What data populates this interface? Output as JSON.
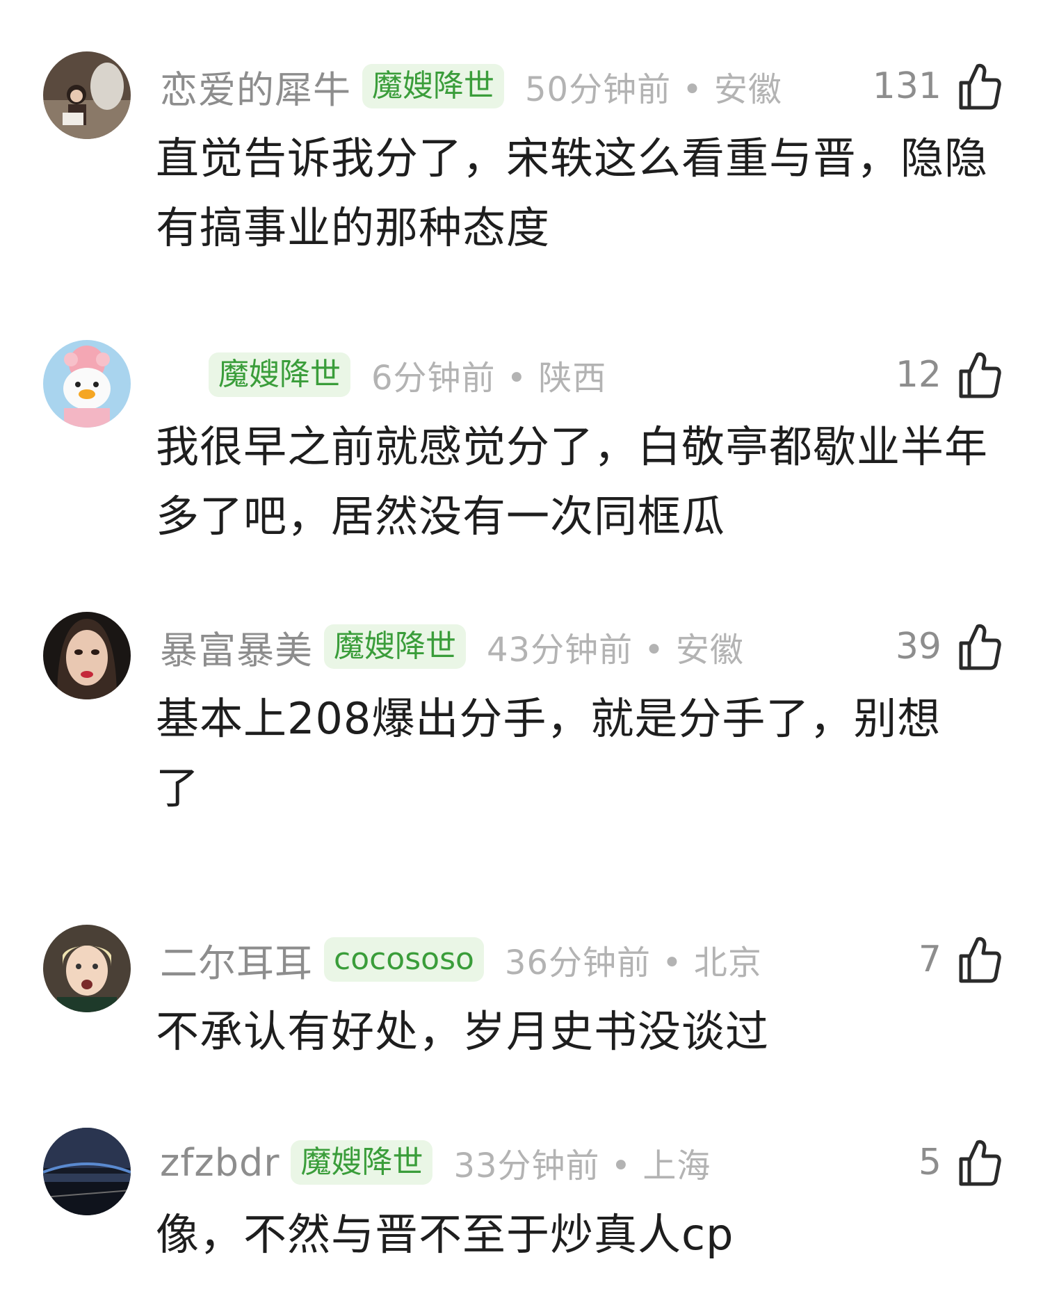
{
  "comments": [
    {
      "username": "恋爱的犀牛",
      "badge": "魔嫂降世",
      "time_location": "50分钟前 • 安徽",
      "likes": "131",
      "text": "直觉告诉我分了，宋轶这么看重与晋，隐隐有搞事业的那种态度",
      "avatar_icon": "avatar-woman-with-sheep-icon"
    },
    {
      "username": "",
      "badge": "魔嫂降世",
      "time_location": "6分钟前 • 陕西",
      "likes": "12",
      "text": "我很早之前就感觉分了，白敬亭都歇业半年多了吧，居然没有一次同框瓜",
      "avatar_icon": "avatar-duck-doll-icon"
    },
    {
      "username": "暴富暴美",
      "badge": "魔嫂降世",
      "time_location": "43分钟前 • 安徽",
      "likes": "39",
      "text": "基本上208爆出分手，就是分手了，别想了",
      "avatar_icon": "avatar-woman-portrait-icon"
    },
    {
      "username": "二尔耳耳",
      "badge": "cocososo",
      "time_location": "36分钟前 • 北京",
      "likes": "7",
      "text": "不承认有好处，岁月史书没谈过",
      "avatar_icon": "avatar-blond-boy-icon"
    },
    {
      "username": "zfzbdr",
      "badge": "魔嫂降世",
      "time_location": "33分钟前 • 上海",
      "likes": "5",
      "text": "像，不然与晋不至于炒真人cp",
      "avatar_icon": "avatar-night-bridge-icon"
    }
  ],
  "colors": {
    "badge_bg": "#eaf6e6",
    "badge_text": "#3a9d3a",
    "meta_gray": "#8d8d8d",
    "time_gray": "#b3b3b3",
    "body_text": "#1e1e1e"
  }
}
